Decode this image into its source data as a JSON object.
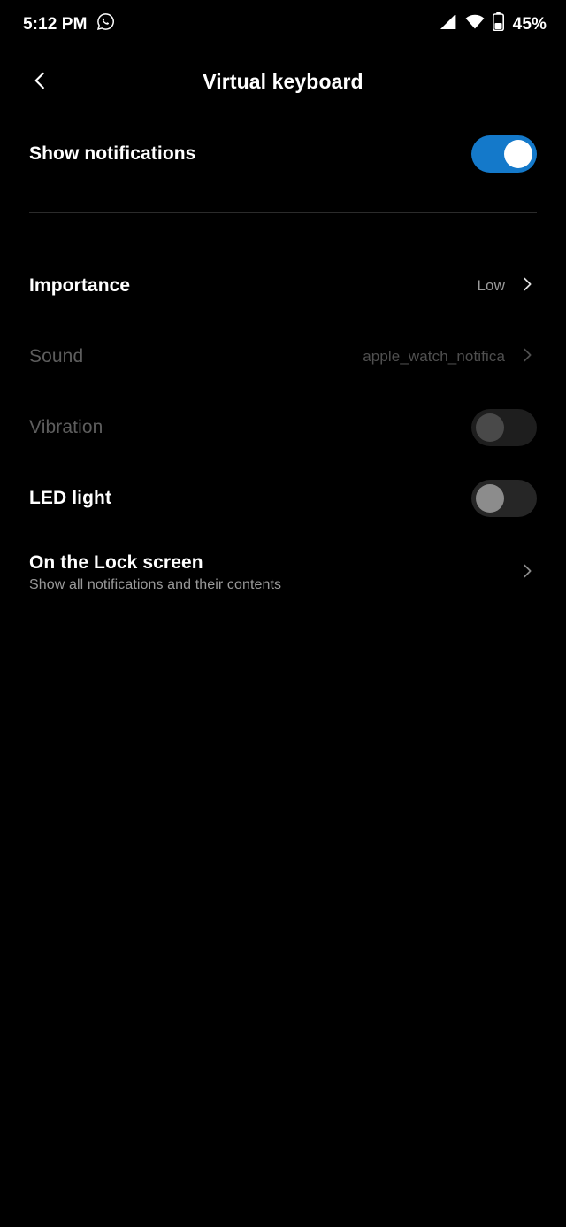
{
  "status_bar": {
    "time": "5:12 PM",
    "notification_icon": "whatsapp-icon",
    "signal_icon": "cellular-signal-icon",
    "wifi_icon": "wifi-icon",
    "battery_icon": "battery-icon",
    "battery_percent": "45%"
  },
  "app_bar": {
    "back_icon": "back-chevron-icon",
    "title": "Virtual keyboard"
  },
  "settings": {
    "show_notifications": {
      "label": "Show notifications",
      "toggle_state": "on"
    },
    "importance": {
      "label": "Importance",
      "value": "Low",
      "chevron_icon": "chevron-right-icon"
    },
    "sound": {
      "label": "Sound",
      "value": "apple_watch_notifica",
      "chevron_icon": "chevron-right-icon",
      "enabled": false
    },
    "vibration": {
      "label": "Vibration",
      "toggle_state": "off",
      "enabled": false
    },
    "led_light": {
      "label": "LED light",
      "toggle_state": "off",
      "enabled": true
    },
    "lock_screen": {
      "label": "On the Lock screen",
      "subtitle": "Show all notifications and their contents",
      "chevron_icon": "chevron-right-icon"
    }
  },
  "colors": {
    "background": "#000000",
    "toggle_on": "#1479ca",
    "text_primary": "#ffffff",
    "text_secondary": "#9a9a9a",
    "text_disabled": "#5d5d5d",
    "divider": "#2b2b2b"
  }
}
